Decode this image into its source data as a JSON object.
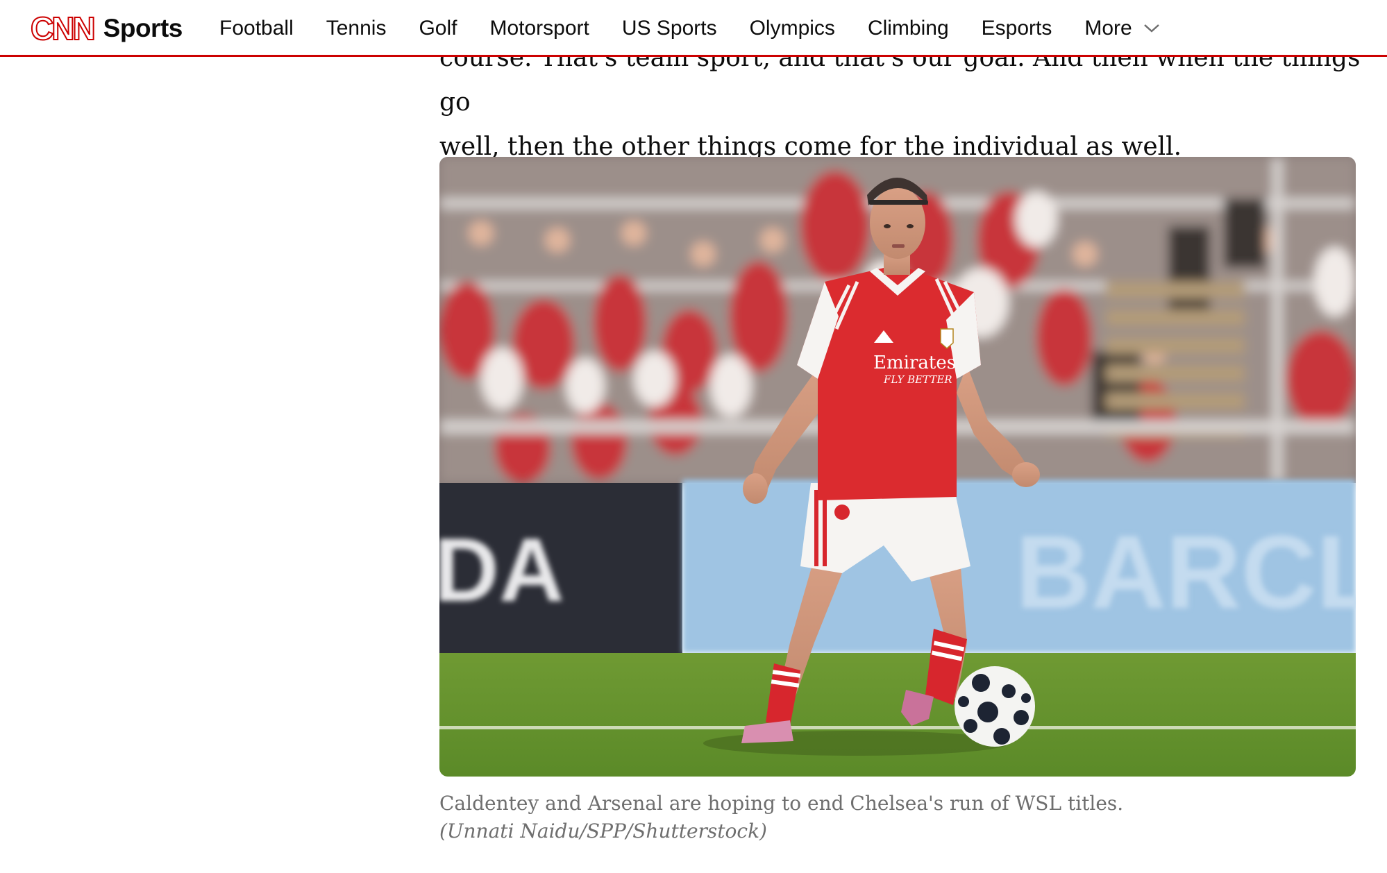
{
  "header": {
    "logo_text": "CNN",
    "section_label": "Sports",
    "nav_items": [
      "Football",
      "Tennis",
      "Golf",
      "Motorsport",
      "US Sports",
      "Olympics",
      "Climbing",
      "Esports"
    ],
    "more_label": "More",
    "accent_color": "#cc0000"
  },
  "article": {
    "partial_line": "course. That's team sport, and that's our goal. And then when the things go",
    "last_line": "well, then the other things come for the individual as well."
  },
  "image": {
    "caption": "Caldentey and Arsenal are hoping to end Chelsea's run of WSL titles.",
    "credit": "(Unnati Naidu/SPP/Shutterstock)",
    "shirt_sponsor": "Emirates",
    "shirt_tagline": "FLY BETTER",
    "board_left_text": "DA",
    "board_right_text": "BARCL"
  }
}
